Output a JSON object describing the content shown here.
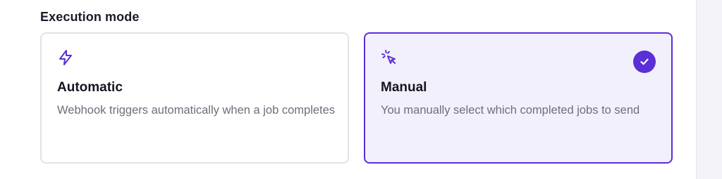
{
  "section": {
    "title": "Execution mode"
  },
  "options": [
    {
      "title": "Automatic",
      "description": "Webhook triggers automatically when a job completes",
      "icon": "lightning-icon",
      "selected": false
    },
    {
      "title": "Manual",
      "description": "You manually select which completed jobs to send",
      "icon": "cursor-click-icon",
      "selected": true
    }
  ],
  "colors": {
    "accent": "#5b2fd6",
    "selected_background": "#f3f0fd",
    "unselected_border": "#e3e3e8",
    "title_text": "#16151f",
    "description_text": "#6f6e7a"
  }
}
